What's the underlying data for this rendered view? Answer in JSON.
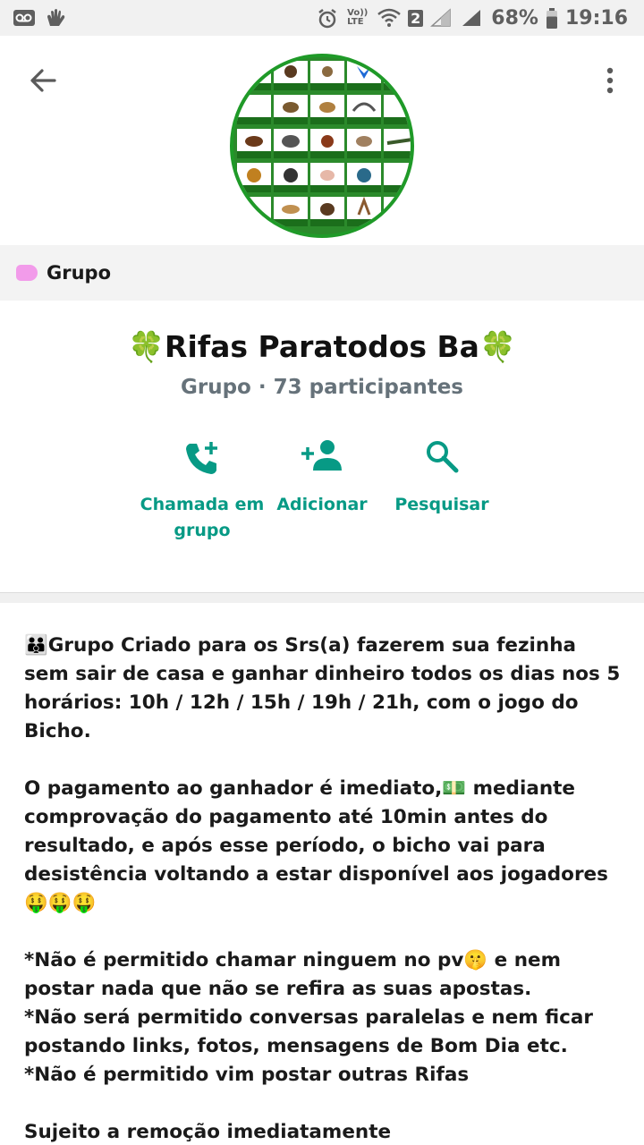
{
  "status_bar": {
    "lte_label": "Vo)) LTE",
    "sim_badge": "2",
    "battery_percent": "68%",
    "time": "19:16"
  },
  "header": {
    "back_icon": "arrow-left-icon",
    "more_icon": "vertical-dots-icon",
    "avatar_description_icon": "animal-grid-avatar"
  },
  "label": {
    "text": "Grupo",
    "color": "#f29bea"
  },
  "group": {
    "title": "🍀Rifas Paratodos Ba🍀",
    "subtitle": "Grupo · 73 participantes"
  },
  "actions": [
    {
      "label": "Chamada em\ngrupo",
      "icon": "group-call-icon"
    },
    {
      "label": "Adicionar",
      "icon": "add-person-icon"
    },
    {
      "label": "Pesquisar",
      "icon": "search-icon"
    }
  ],
  "accent_color": "#079a85",
  "description": "👪Grupo Criado para os Srs(a) fazerem sua fezinha sem sair de casa e ganhar dinheiro todos os dias nos 5 horários: 10h / 12h / 15h / 19h / 21h, com o jogo do Bicho.\n\nO pagamento ao ganhador é imediato,💵 mediante comprovação do pagamento até 10min antes do resultado, e após esse período, o bicho vai para desistência voltando a estar disponível aos jogadores 🤑🤑🤑\n\n*Não é permitido chamar ninguem no pv🤫 e nem postar nada que não se refira as suas apostas.\n*Não será permitido conversas paralelas e nem ficar postando links, fotos, mensagens de Bom Dia etc.\n*Não é permitido vim postar outras Rifas\n\nSujeito a remoção imediatamente"
}
